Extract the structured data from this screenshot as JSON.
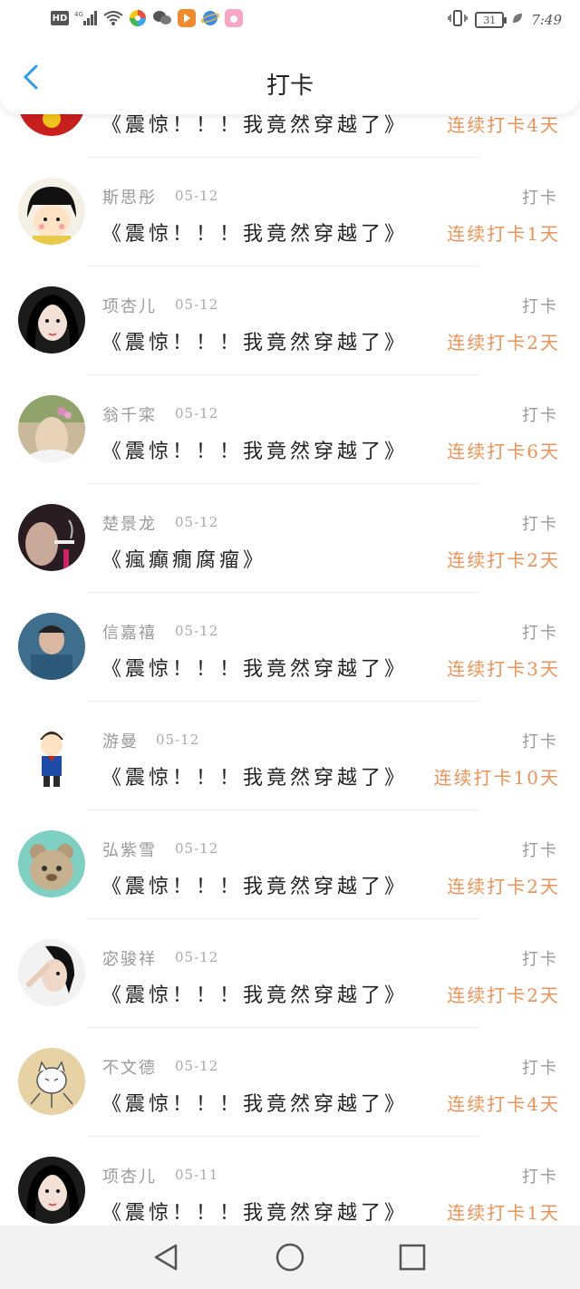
{
  "status_bar": {
    "network": "HD",
    "signal_label": "4G",
    "battery": "31",
    "time": "7:49"
  },
  "header": {
    "title": "打卡"
  },
  "entries": [
    {
      "name": "",
      "date": "",
      "title": "《震惊！！！我竟然穿越了》",
      "action": "",
      "streak": "连续打卡4天",
      "avatar": "red"
    },
    {
      "name": "斯思彤",
      "date": "05-12",
      "title": "《震惊！！！我竟然穿越了》",
      "action": "打卡",
      "streak": "连续打卡1天",
      "avatar": "maruko"
    },
    {
      "name": "项杏儿",
      "date": "05-12",
      "title": "《震惊！！！我竟然穿越了》",
      "action": "打卡",
      "streak": "连续打卡2天",
      "avatar": "girl-dark"
    },
    {
      "name": "翁千寀",
      "date": "05-12",
      "title": "《震惊！！！我竟然穿越了》",
      "action": "打卡",
      "streak": "连续打卡6天",
      "avatar": "girl-flowers"
    },
    {
      "name": "楚景龙",
      "date": "05-12",
      "title": "《瘋癲癇腐瘤》",
      "action": "打卡",
      "streak": "连续打卡2天",
      "avatar": "smoke"
    },
    {
      "name": "信嘉禧",
      "date": "05-12",
      "title": "《震惊！！！我竟然穿越了》",
      "action": "打卡",
      "streak": "连续打卡3天",
      "avatar": "boy-blue"
    },
    {
      "name": "游曼",
      "date": "05-12",
      "title": "《震惊！！！我竟然穿越了》",
      "action": "打卡",
      "streak": "连续打卡10天",
      "avatar": "conan"
    },
    {
      "name": "弘紫雪",
      "date": "05-12",
      "title": "《震惊！！！我竟然穿越了》",
      "action": "打卡",
      "streak": "连续打卡2天",
      "avatar": "bear"
    },
    {
      "name": "宓骏祥",
      "date": "05-12",
      "title": "《震惊！！！我竟然穿越了》",
      "action": "打卡",
      "streak": "连续打卡2天",
      "avatar": "girl-pose"
    },
    {
      "name": "不文德",
      "date": "05-12",
      "title": "《震惊！！！我竟然穿越了》",
      "action": "打卡",
      "streak": "连续打卡4天",
      "avatar": "cat-sketch"
    },
    {
      "name": "项杏儿",
      "date": "05-11",
      "title": "《震惊！！！我竟然穿越了》",
      "action": "打卡",
      "streak": "连续打卡1天",
      "avatar": "girl-dark"
    }
  ],
  "colors": {
    "accent_back": "#2f9be8",
    "streak": "#e8935a",
    "muted": "#9a9a9a"
  }
}
